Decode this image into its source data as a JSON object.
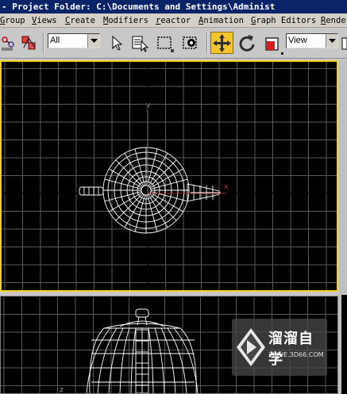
{
  "window": {
    "title": " - Project Folder: C:\\Documents and Settings\\Administ"
  },
  "menu": {
    "items": [
      {
        "label": "Group"
      },
      {
        "label": "Views"
      },
      {
        "label": "Create"
      },
      {
        "label": "Modifiers"
      },
      {
        "label": "reactor"
      },
      {
        "label": "Animation"
      },
      {
        "label": "Graph Editors"
      },
      {
        "label": "Rende"
      }
    ]
  },
  "toolbar": {
    "selection_filter": "All",
    "reference_coord": "View",
    "active_tool": "select-and-move",
    "colors": {
      "active": "#f4c42c",
      "viewport_border_active": "#f0d020"
    },
    "icons": [
      "link-icon",
      "unlink-icon",
      "cursor-arrow-icon",
      "select-by-name-icon",
      "rectangular-selection-icon",
      "window-crossing-icon",
      "move-icon",
      "rotate-icon",
      "scale-icon"
    ]
  },
  "viewports": {
    "top_axis": {
      "x": "x",
      "y": "y"
    },
    "front_axis": {
      "z": "z"
    }
  },
  "watermark": {
    "brand": "溜溜自学",
    "url": "ZIXUE.3D66.COM"
  }
}
